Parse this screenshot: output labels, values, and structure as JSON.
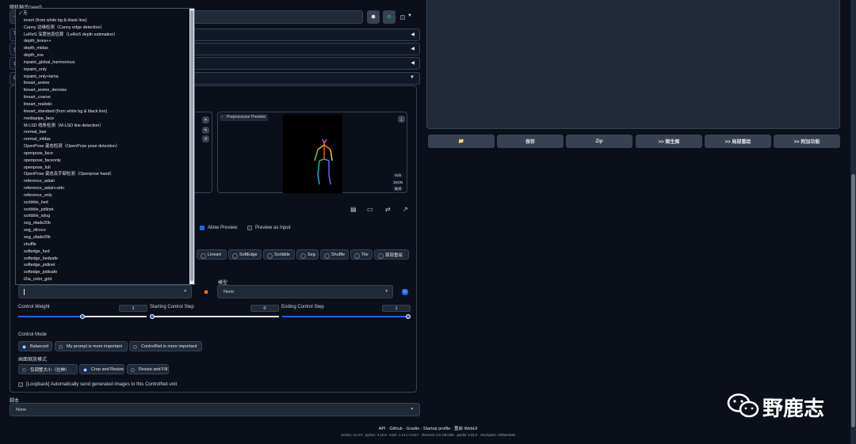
{
  "seed": {
    "label": "随机种子(seed)",
    "value": "-1"
  },
  "accordions": [
    {
      "label": "Ti",
      "arrow": "◀"
    },
    {
      "label": "分",
      "arrow": "◀"
    },
    {
      "label": "可",
      "arrow": "◀"
    },
    {
      "label": "Co",
      "arrow": "▼"
    }
  ],
  "preprocessor_list": {
    "items": [
      "✓ 无",
      "invert (from white bg & black line)",
      "Canny 边缘检测（Canny edge detection）",
      "LeReS 深度信息估算（LeReS depth estimation）",
      "depth_leres++",
      "depth_midas",
      "depth_zoe",
      "inpaint_global_harmonious",
      "inpaint_only",
      "inpaint_only+lama",
      "lineart_anime",
      "lineart_anime_denoise",
      "lineart_coarse",
      "lineart_realistic",
      "lineart_standard (from white bg & black line)",
      "mediapipe_face",
      "M-LSD 线条检测（M-LSD line detection）",
      "normal_bae",
      "normal_midas",
      "OpenPose 姿态检测（OpenPose pose detection）",
      "openpose_face",
      "openpose_faceonly",
      "openpose_full",
      "OpenPose 姿态及手部检测（Openpose hand）",
      "reference_adain",
      "reference_adain+attn",
      "reference_only",
      "scribble_hed",
      "scribble_pidinet",
      "scribble_xdog",
      "seg_ofade20k",
      "seg_ofcoco",
      "seg_ufade20k",
      "shuffle",
      "softedge_hed",
      "softedge_hedsafe",
      "softedge_pidinet",
      "softedge_pidisafe",
      "t2ia_color_grid"
    ]
  },
  "preview": {
    "label": "Preprocessor Preview",
    "edit": "Edit",
    "json": "JSON",
    "close": "关闭"
  },
  "options": {
    "allow_preview": "Allow Preview",
    "preview_as_input": "Preview as Input"
  },
  "control_types": [
    "Lineart",
    "SoftEdge",
    "Scribble",
    "Seg",
    "Shuffle",
    "Tile",
    "局部重绘"
  ],
  "model": {
    "label": "模型",
    "value": "None"
  },
  "control_weight": {
    "label": "Control Weight",
    "value": "1"
  },
  "starting_step": {
    "label": "Starting Control Step",
    "value": "0"
  },
  "ending_step": {
    "label": "Ending Control Step",
    "value": "1"
  },
  "control_mode": {
    "label": "Control Mode",
    "options": [
      "Balanced",
      "My prompt is more important",
      "ControlNet is more important"
    ]
  },
  "resize_mode": {
    "label": "画面缩放模式",
    "options": [
      "仅调整大小（拉伸）",
      "Crop and Resize",
      "Resize and Fill"
    ]
  },
  "loopback": {
    "label": "[Loopback] Automatically send generated images to this ControlNet unit"
  },
  "script": {
    "label": "脚本",
    "value": "None"
  },
  "output_buttons": [
    "📁",
    "保存",
    "Zip",
    ">> 图生图",
    ">> 局部重绘",
    ">> 附加功能"
  ],
  "footer": {
    "links": "API · Github · Gradio · Startup profile · 重启 WebUI",
    "version": "version: v1.4.0  ·  python: 3.10.6  ·  torch: 1.13.1+cu117  ·  xformers: 0.0.16rc425  ·  gradio: 3.32.0  ·  checkpoint: cbf0a64e66"
  },
  "watermark": "野鹿志",
  "colors": {
    "accent": "#2563eb",
    "background": "#0b0f19",
    "panel": "#111827",
    "field": "#1f2937"
  }
}
